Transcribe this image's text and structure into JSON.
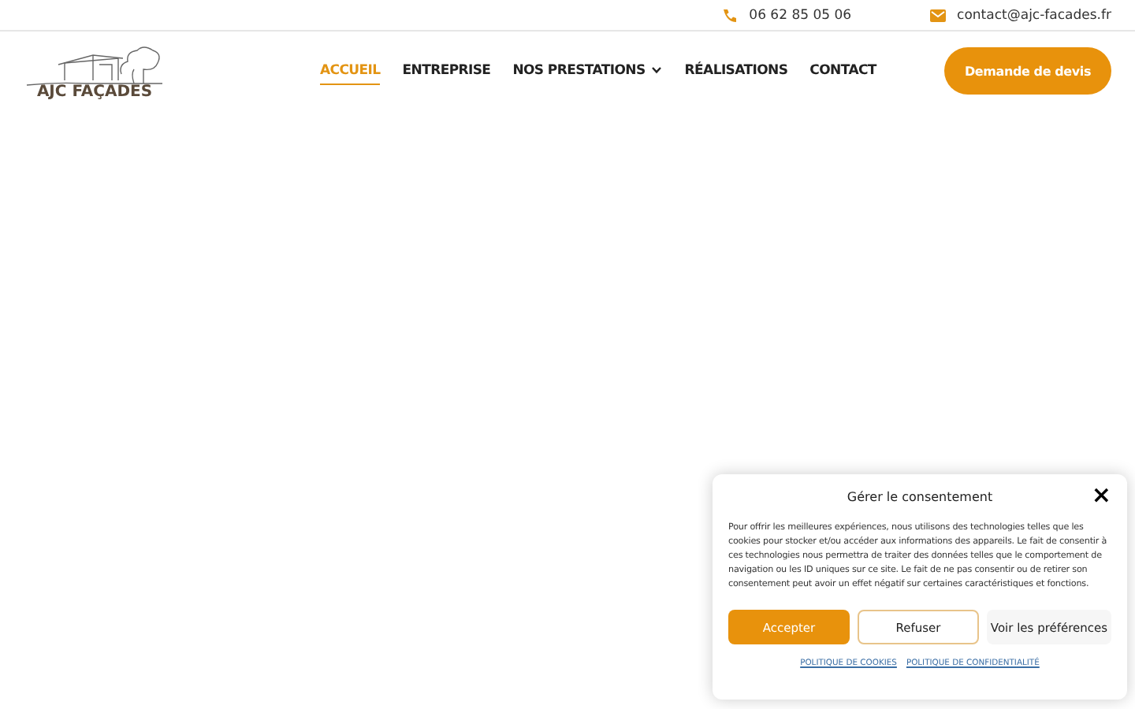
{
  "topbar": {
    "phone": "06 62 85 05 06",
    "email": "contact@ajc-facades.fr"
  },
  "logo": {
    "text": "AJC FAÇADES"
  },
  "nav": [
    {
      "label": "ACCUEIL",
      "selected": true,
      "dropdown": false
    },
    {
      "label": "ENTREPRISE",
      "selected": false,
      "dropdown": false
    },
    {
      "label": "NOS PRESTATIONS",
      "selected": false,
      "dropdown": true
    },
    {
      "label": "RÉALISATIONS",
      "selected": false,
      "dropdown": false
    },
    {
      "label": "CONTACT",
      "selected": false,
      "dropdown": false
    }
  ],
  "cta": "Demande de devis",
  "consent": {
    "title": "Gérer le consentement",
    "close": "×",
    "body": "Pour offrir les meilleures expériences, nous utilisons des technologies telles que les cookies pour stocker et/ou accéder aux informations des appareils. Le fait de consentir à ces technologies nous permettra de traiter des données telles que le comportement de navigation ou les ID uniques sur ce site. Le fait de ne pas consentir ou de retirer son consentement peut avoir un effet négatif sur certaines caractéristiques et fonctions.",
    "buttons": [
      {
        "label": "Accepter",
        "kind": "primary"
      },
      {
        "label": "Refuser",
        "kind": "outline"
      },
      {
        "label": "Voir les préférences",
        "kind": "plain"
      }
    ],
    "links": [
      "POLITIQUE DE COOKIES",
      "POLITIQUE DE CONFIDENTIALITÉ"
    ]
  }
}
